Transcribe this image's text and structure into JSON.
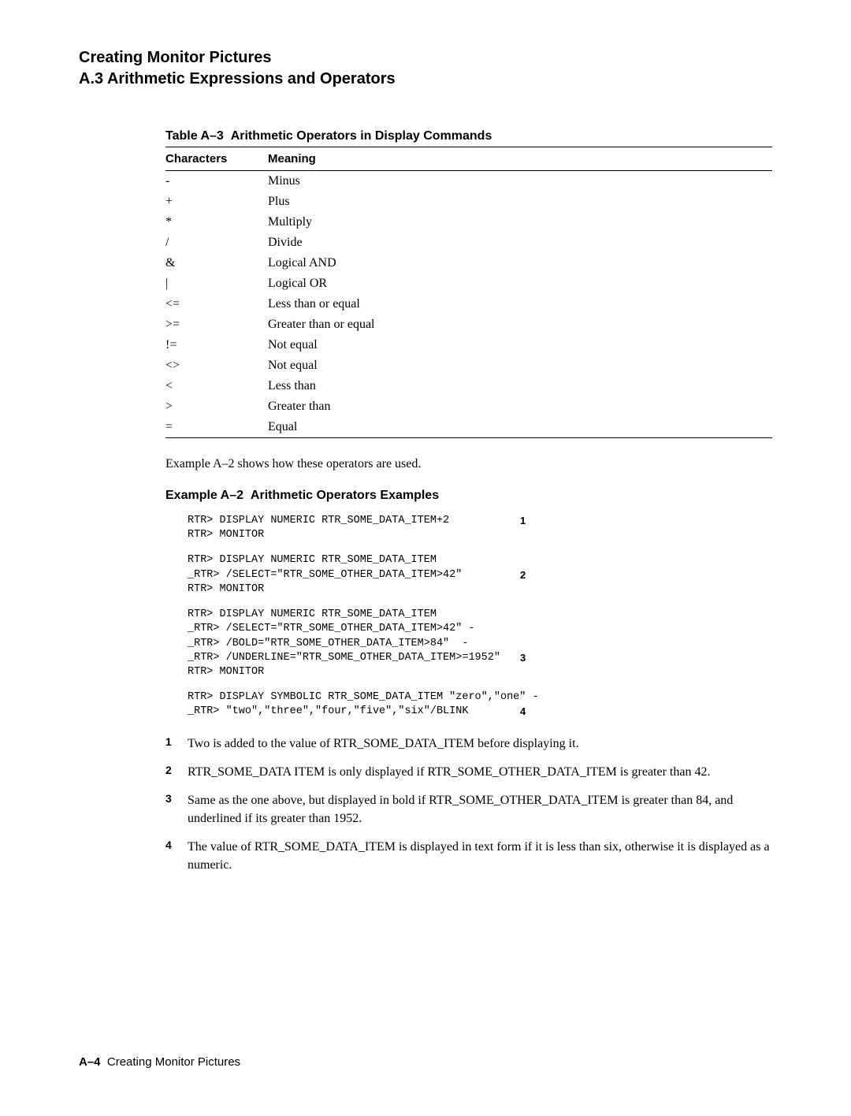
{
  "heading": {
    "line1": "Creating Monitor Pictures",
    "line2": "A.3 Arithmetic Expressions and Operators"
  },
  "table": {
    "caption_label": "Table A–3",
    "caption_title": "Arithmetic Operators in Display Commands",
    "col1": "Characters",
    "col2": "Meaning",
    "rows": [
      {
        "c": "-",
        "m": "Minus"
      },
      {
        "c": "+",
        "m": "Plus"
      },
      {
        "c": "*",
        "m": "Multiply"
      },
      {
        "c": "/",
        "m": "Divide"
      },
      {
        "c": "&",
        "m": "Logical AND"
      },
      {
        "c": "|",
        "m": "Logical OR"
      },
      {
        "c": "<=",
        "m": "Less than or equal"
      },
      {
        "c": ">=",
        "m": "Greater than or equal"
      },
      {
        "c": "!=",
        "m": "Not equal"
      },
      {
        "c": "<>",
        "m": "Not equal"
      },
      {
        "c": "<",
        "m": "Less than"
      },
      {
        "c": ">",
        "m": "Greater than"
      },
      {
        "c": "=",
        "m": "Equal"
      }
    ]
  },
  "para1": "Example A–2 shows how these operators are used.",
  "example": {
    "label": "Example A–2",
    "title": "Arithmetic Operators Examples",
    "groups": [
      {
        "lines": [
          {
            "t": "RTR> DISPLAY NUMERIC RTR_SOME_DATA_ITEM+2",
            "a": "1"
          },
          {
            "t": "RTR> MONITOR",
            "a": ""
          }
        ]
      },
      {
        "lines": [
          {
            "t": "RTR> DISPLAY NUMERIC RTR_SOME_DATA_ITEM",
            "a": ""
          },
          {
            "t": "_RTR> /SELECT=\"RTR_SOME_OTHER_DATA_ITEM>42\"",
            "a": "2"
          },
          {
            "t": "RTR> MONITOR",
            "a": ""
          }
        ]
      },
      {
        "lines": [
          {
            "t": "RTR> DISPLAY NUMERIC RTR_SOME_DATA_ITEM",
            "a": ""
          },
          {
            "t": "_RTR> /SELECT=\"RTR_SOME_OTHER_DATA_ITEM>42\" -",
            "a": ""
          },
          {
            "t": "_RTR> /BOLD=\"RTR_SOME_OTHER_DATA_ITEM>84\"  -",
            "a": ""
          },
          {
            "t": "_RTR> /UNDERLINE=\"RTR_SOME_OTHER_DATA_ITEM>=1952\"",
            "a": "3"
          },
          {
            "t": "RTR> MONITOR",
            "a": ""
          }
        ]
      },
      {
        "lines": [
          {
            "t": "RTR> DISPLAY SYMBOLIC RTR_SOME_DATA_ITEM \"zero\",\"one\" -",
            "a": ""
          },
          {
            "t": "_RTR> \"two\",\"three\",\"four,\"five\",\"six\"/BLINK",
            "a": "4"
          }
        ]
      }
    ]
  },
  "notes": [
    {
      "n": "1",
      "t": "Two is added to the value of RTR_SOME_DATA_ITEM before displaying it."
    },
    {
      "n": "2",
      "t": "RTR_SOME_DATA ITEM is only displayed if RTR_SOME_OTHER_DATA_ITEM is greater than 42."
    },
    {
      "n": "3",
      "t": "Same as the one above, but displayed in bold if RTR_SOME_OTHER_DATA_ITEM is greater than 84, and underlined if its greater than 1952."
    },
    {
      "n": "4",
      "t": "The value of RTR_SOME_DATA_ITEM is displayed in text form if it is less than six, otherwise it is displayed as a numeric."
    }
  ],
  "footer": {
    "page": "A–4",
    "section": "Creating Monitor Pictures"
  }
}
